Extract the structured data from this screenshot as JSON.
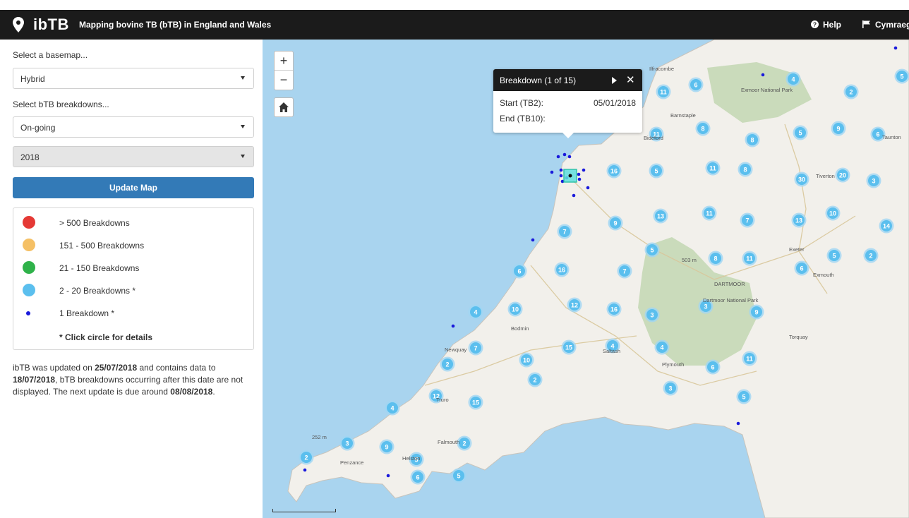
{
  "app": {
    "brand": "ibTB",
    "subtitle": "Mapping bovine TB (bTB) in England and Wales",
    "help_label": "Help",
    "language_label": "Cymraeg"
  },
  "sidebar": {
    "basemap_label": "Select a basemap...",
    "basemap_value": "Hybrid",
    "breakdowns_label": "Select bTB breakdowns...",
    "breakdowns_value": "On-going",
    "year_value": "2018",
    "update_button": "Update Map"
  },
  "legend": {
    "items": [
      {
        "label": "> 500 Breakdowns",
        "color": "#e53935"
      },
      {
        "label": "151 - 500 Breakdowns",
        "color": "#f5c065"
      },
      {
        "label": "21 - 150 Breakdowns",
        "color": "#2fb24a"
      },
      {
        "label": "2 - 20 Breakdowns *",
        "color": "#5bbfee"
      },
      {
        "label": "1 Breakdown *",
        "color": "#1a1adb"
      }
    ],
    "note": "* Click circle for details"
  },
  "info": {
    "p1": "ibTB was updated on ",
    "updated": "25/07/2018",
    "p2": " and contains data to ",
    "data_to": "18/07/2018",
    "p3": ", bTB breakdowns occurring after this date are not displayed. The next update is due around ",
    "next_update": "08/08/2018",
    "p4": "."
  },
  "map": {
    "zoom_in": "+",
    "zoom_out": "−",
    "place_labels": [
      "Ilfracombe",
      "Exmoor National Park",
      "Barnstaple",
      "Bideford",
      "Tiverton",
      "Taunton",
      "Exeter",
      "Exmouth",
      "DARTMOOR",
      "Dartmoor National Park",
      "503 m",
      "Torquay",
      "Plymouth",
      "Saltash",
      "Bodmin",
      "Newquay",
      "Truro",
      "Falmouth",
      "Helston",
      "Penzance",
      "252 m"
    ],
    "clusters": [
      {
        "label": "11"
      },
      {
        "label": "6"
      },
      {
        "label": "4"
      },
      {
        "label": "5"
      },
      {
        "label": "2"
      },
      {
        "label": "11"
      },
      {
        "label": "8"
      },
      {
        "label": "8"
      },
      {
        "label": "5"
      },
      {
        "label": "9"
      },
      {
        "label": "6"
      },
      {
        "label": "16"
      },
      {
        "label": "5"
      },
      {
        "label": "11"
      },
      {
        "label": "8"
      },
      {
        "label": "30"
      },
      {
        "label": "20"
      },
      {
        "label": "3"
      },
      {
        "label": "9"
      },
      {
        "label": "13"
      },
      {
        "label": "11"
      },
      {
        "label": "7"
      },
      {
        "label": "13"
      },
      {
        "label": "10"
      },
      {
        "label": "14"
      },
      {
        "label": "7"
      },
      {
        "label": "5"
      },
      {
        "label": "8"
      },
      {
        "label": "11"
      },
      {
        "label": "5"
      },
      {
        "label": "2"
      },
      {
        "label": "6"
      },
      {
        "label": "16"
      },
      {
        "label": "7"
      },
      {
        "label": "6"
      },
      {
        "label": "4"
      },
      {
        "label": "10"
      },
      {
        "label": "12"
      },
      {
        "label": "16"
      },
      {
        "label": "3"
      },
      {
        "label": "3"
      },
      {
        "label": "9"
      },
      {
        "label": "7"
      },
      {
        "label": "15"
      },
      {
        "label": "4"
      },
      {
        "label": "4"
      },
      {
        "label": "11"
      },
      {
        "label": "2"
      },
      {
        "label": "10"
      },
      {
        "label": "6"
      },
      {
        "label": "2"
      },
      {
        "label": "12"
      },
      {
        "label": "15"
      },
      {
        "label": "3"
      },
      {
        "label": "5"
      },
      {
        "label": "4"
      },
      {
        "label": "5"
      },
      {
        "label": "2"
      },
      {
        "label": "3"
      },
      {
        "label": "9"
      },
      {
        "label": "6"
      },
      {
        "label": "2"
      },
      {
        "label": "5"
      }
    ]
  },
  "popup": {
    "title": "Breakdown (1 of 15)",
    "start_label": "Start (TB2):",
    "start_value": "05/01/2018",
    "end_label": "End (TB10):",
    "end_value": ""
  }
}
